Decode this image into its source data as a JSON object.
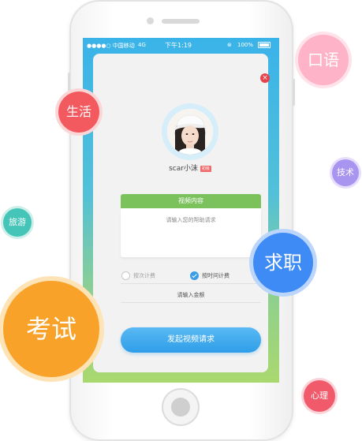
{
  "statusbar": {
    "carrier": "●●●●○ 中国移动",
    "network": "4G",
    "time": "下午1:19",
    "battery": "100%"
  },
  "dialog": {
    "close_icon": "×",
    "user": {
      "name": "scar小沫",
      "badge": "初级"
    },
    "video_content": {
      "title": "视频内容",
      "placeholder": "请输入您的帮助请求"
    },
    "billing": {
      "options": [
        {
          "label": "按次计费",
          "checked": false
        },
        {
          "label": "按时间计费",
          "checked": true
        }
      ]
    },
    "amount_placeholder": "请输入金额",
    "submit_label": "发起视频请求"
  },
  "bubbles": {
    "kouyu": "口语",
    "shenghuo": "生活",
    "jishu": "技术",
    "lvyou": "旅游",
    "qiuzhi": "求职",
    "kaoshi": "考试",
    "xinli": "心理"
  },
  "colors": {
    "accent_blue": "#2f9ee8",
    "header_green": "#7cc25c",
    "close_red": "#e8424a"
  }
}
